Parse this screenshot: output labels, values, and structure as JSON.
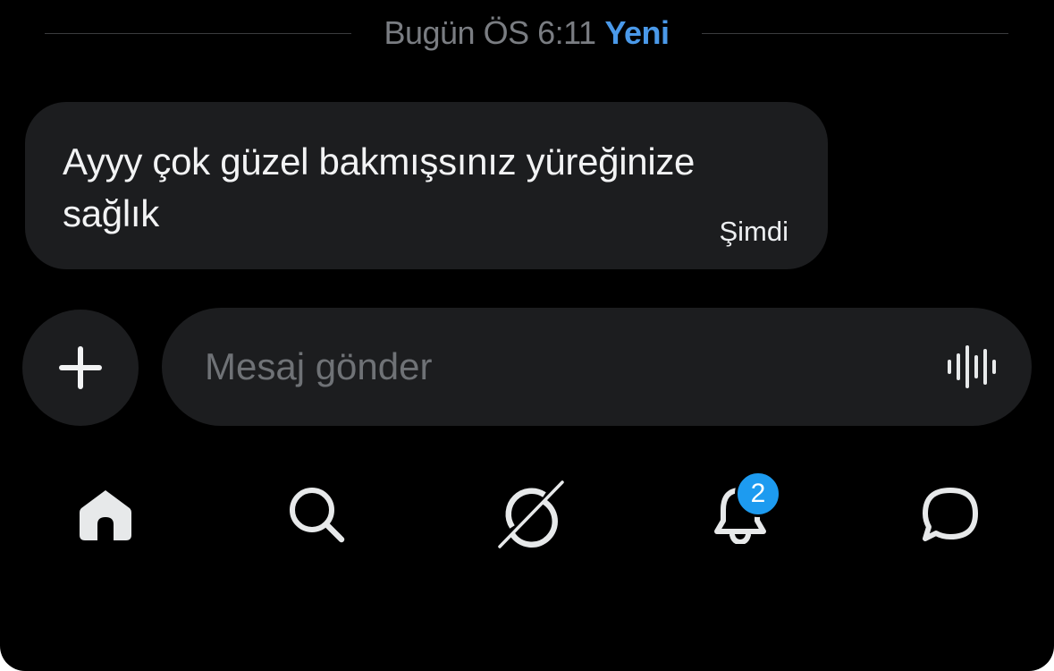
{
  "divider": {
    "date": "Bugün ÖS 6:11",
    "new_label": "Yeni"
  },
  "message": {
    "text": "Ayyy çok güzel bakmışsınız yüreğinize sağlık",
    "time": "Şimdi"
  },
  "composer": {
    "placeholder": "Mesaj gönder",
    "plus_icon": "plus-icon",
    "voice_icon": "voice-wave-icon"
  },
  "nav": {
    "items": [
      {
        "icon": "home-icon",
        "active": true
      },
      {
        "icon": "search-icon",
        "active": false
      },
      {
        "icon": "grok-icon",
        "active": false
      },
      {
        "icon": "bell-icon",
        "active": false,
        "badge": "2"
      },
      {
        "icon": "chat-bubble-icon",
        "active": false
      }
    ]
  },
  "colors": {
    "background": "#000000",
    "bubble": "#1c1d1f",
    "accent": "#4a99e9",
    "badge": "#1d9bf0",
    "muted_text": "#7a7d82"
  }
}
